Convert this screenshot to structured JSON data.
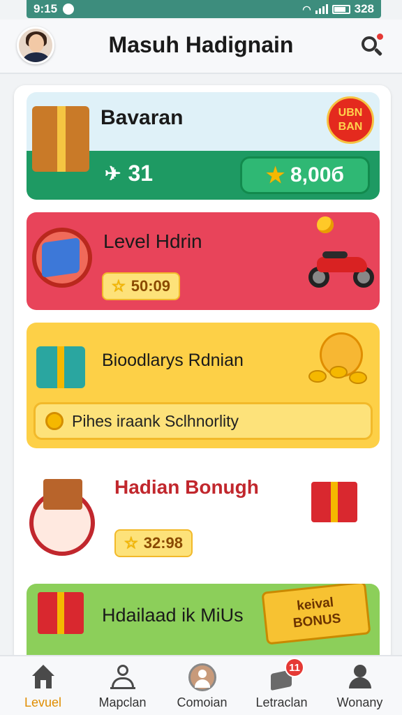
{
  "status_bar": {
    "time": "9:15",
    "battery": "328"
  },
  "header": {
    "title": "Masuh Hadignain"
  },
  "cards": [
    {
      "title": "Bavaran",
      "left_stat": "31",
      "right_value": "8,00б",
      "badge": "UBN BAN"
    },
    {
      "title": "Level Hdrin",
      "value": "50:09"
    },
    {
      "title": "Bioodlarys Rdnian",
      "banner": "Pihes iraank Sclhnorlity"
    },
    {
      "title": "Hadian Bonugh",
      "value": "32:98"
    },
    {
      "title": "Hdailaad ik MiUs",
      "bonus_line1": "keival",
      "bonus_line2": "BONUS"
    }
  ],
  "bottom_nav": [
    {
      "label": "Levuel",
      "active": true
    },
    {
      "label": "Mapclan"
    },
    {
      "label": "Comoian"
    },
    {
      "label": "Letraclan",
      "badge": "11"
    },
    {
      "label": "Wonany"
    }
  ],
  "colors": {
    "status_bar": "#3d8d7d",
    "active_nav": "#e08d00",
    "card_green": "#1e9a63",
    "card_red": "#e8445a",
    "card_yellow": "#fdd047",
    "card_lime": "#8ccf5a"
  }
}
